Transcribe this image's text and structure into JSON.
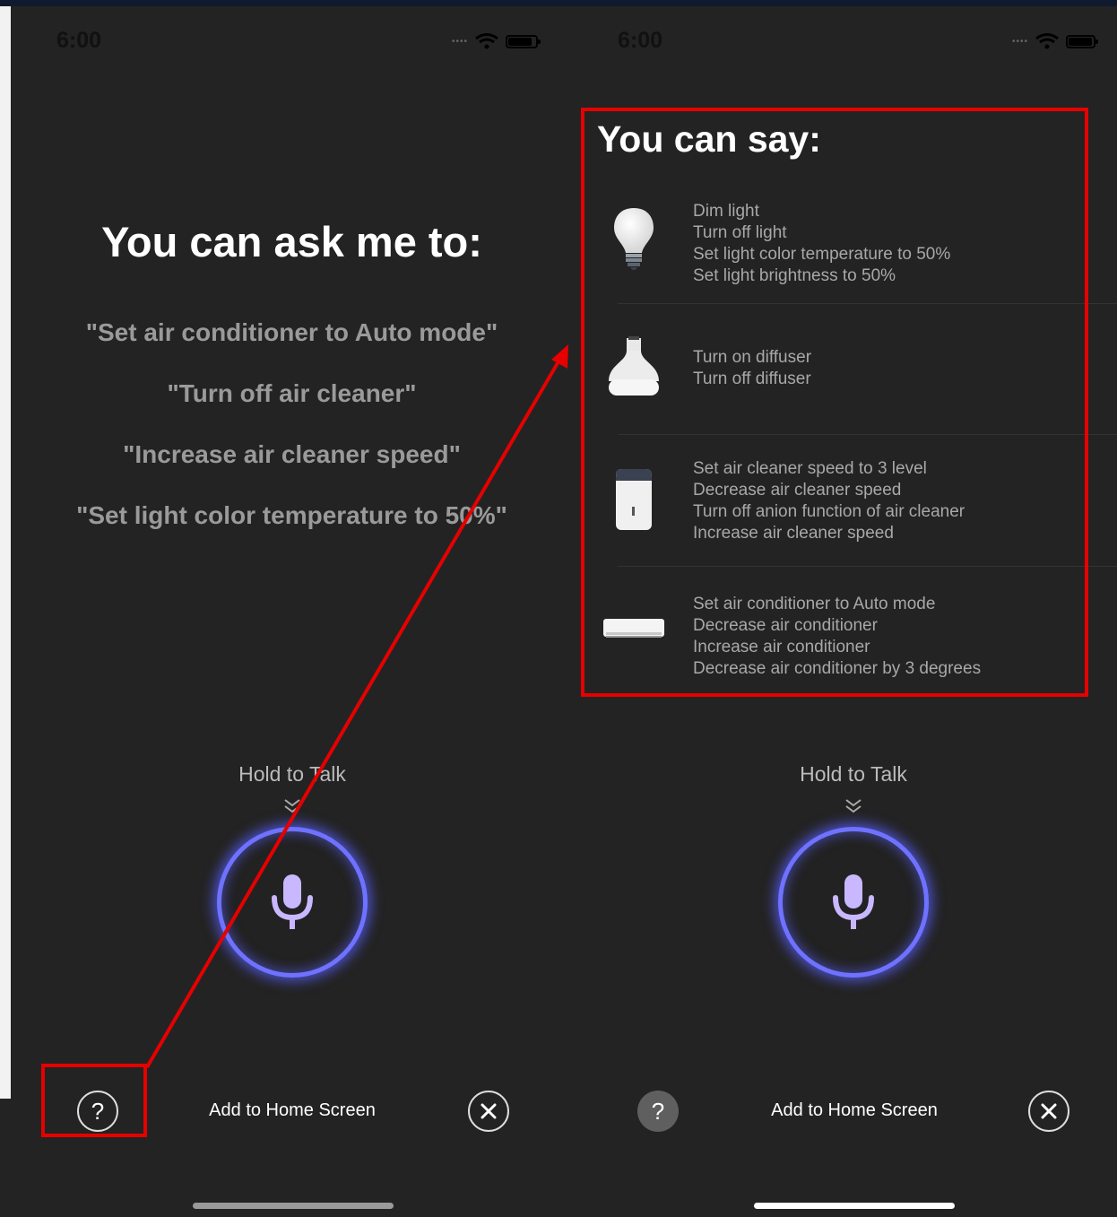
{
  "left_screen": {
    "status": {
      "time": "6:00"
    },
    "heading": "You can ask me to:",
    "phrases": [
      "\"Set air conditioner to Auto mode\"",
      "\"Turn off air cleaner\"",
      "\"Increase air cleaner speed\"",
      "\"Set light color temperature to 50%\""
    ],
    "hold_label": "Hold to Talk",
    "add_home_label": "Add to Home Screen",
    "help_icon": "help-icon",
    "close_icon": "close-icon",
    "mic_icon": "microphone-icon"
  },
  "right_screen": {
    "status": {
      "time": "6:00"
    },
    "title": "You can say:",
    "devices": [
      {
        "icon": "light-bulb-icon",
        "commands": [
          "Dim light",
          "Turn off light",
          "Set light color temperature to 50%",
          "Set light brightness to 50%"
        ]
      },
      {
        "icon": "diffuser-icon",
        "commands": [
          "Turn on diffuser",
          "Turn off diffuser"
        ]
      },
      {
        "icon": "air-cleaner-icon",
        "commands": [
          "Set air cleaner speed to 3 level",
          "Decrease air cleaner speed",
          "Turn off anion function of air cleaner",
          "Increase air cleaner speed"
        ]
      },
      {
        "icon": "air-conditioner-icon",
        "commands": [
          "Set air conditioner to Auto mode",
          "Decrease air conditioner",
          "Increase air conditioner",
          "Decrease air conditioner by 3 degrees"
        ]
      }
    ],
    "hold_label": "Hold to Talk",
    "add_home_label": "Add to Home Screen"
  },
  "colors": {
    "background": "#232323",
    "annotation_red": "#e60000",
    "mic_ring": "#6f72ff",
    "mic_glyph": "#c9b8ff"
  }
}
